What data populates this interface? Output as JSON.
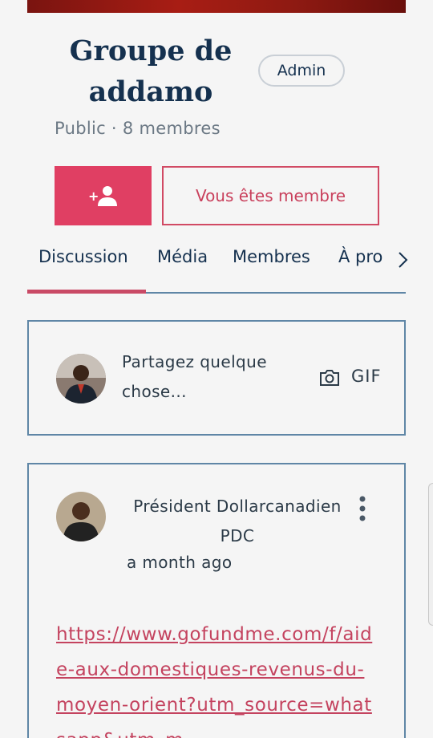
{
  "group": {
    "name": "Groupe de addamo",
    "role_badge": "Admin",
    "meta": "Public · 8 membres"
  },
  "actions": {
    "join_icon": "add-user-icon",
    "member_label": "Vous êtes membre"
  },
  "tabs": [
    {
      "label": "Discussion",
      "active": true
    },
    {
      "label": "Média",
      "active": false
    },
    {
      "label": "Membres",
      "active": false
    },
    {
      "label": "À pro",
      "active": false
    }
  ],
  "composer": {
    "placeholder": "Partagez quelque chose...",
    "gif_label": "GIF"
  },
  "post": {
    "author": "Président Dollarcanadien PDC",
    "time": "a month ago",
    "link": "https://www.gofundme.com/f/aide-aux-domestiques-revenus-du-moyen-orient?utm_source=whatsapp&utm_m"
  },
  "colors": {
    "accent": "#e03f63",
    "title": "#15314f",
    "border": "#5f86a6"
  }
}
